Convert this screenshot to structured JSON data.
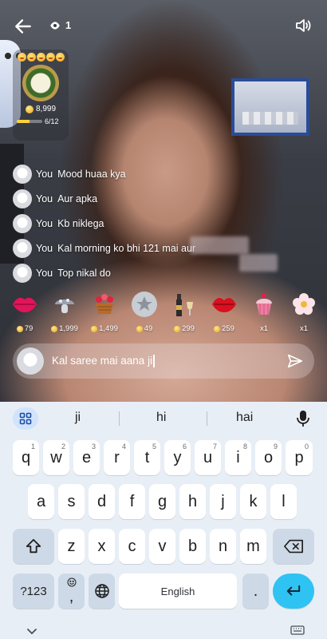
{
  "top_bar": {
    "viewer_count": "1"
  },
  "level_card": {
    "coins": "8,999",
    "progress_text": "6/12",
    "progress": 0.5
  },
  "chat": [
    {
      "user": "You",
      "text": "Mood huaa kya"
    },
    {
      "user": "You",
      "text": "Aur apka"
    },
    {
      "user": "You",
      "text": "Kb niklega"
    },
    {
      "user": "You",
      "text": "Kal morning ko bhi 121 mai aur"
    },
    {
      "user": "You",
      "text": "Top nikal do"
    }
  ],
  "gifts": [
    {
      "icon": "lips-icon",
      "price": "79"
    },
    {
      "icon": "mushroom-icon",
      "price": "1,999"
    },
    {
      "icon": "flower-basket-icon",
      "price": "1,499"
    },
    {
      "icon": "star-badge-icon",
      "price": "49"
    },
    {
      "icon": "champagne-icon",
      "price": "299"
    },
    {
      "icon": "red-lips-icon",
      "price": "259"
    },
    {
      "icon": "cupcake-icon",
      "price": "x1"
    },
    {
      "icon": "flower-icon",
      "price": "x1"
    }
  ],
  "comment": {
    "value": "Kal saree mai aana ji"
  },
  "keyboard": {
    "suggestions": [
      "ji",
      "hi",
      "hai"
    ],
    "row1": [
      {
        "key": "q",
        "hint": "1"
      },
      {
        "key": "w",
        "hint": "2"
      },
      {
        "key": "e",
        "hint": "3"
      },
      {
        "key": "r",
        "hint": "4"
      },
      {
        "key": "t",
        "hint": "5"
      },
      {
        "key": "y",
        "hint": "6"
      },
      {
        "key": "u",
        "hint": "7"
      },
      {
        "key": "i",
        "hint": "8"
      },
      {
        "key": "o",
        "hint": "9"
      },
      {
        "key": "p",
        "hint": "0"
      }
    ],
    "row2": [
      "a",
      "s",
      "d",
      "f",
      "g",
      "h",
      "j",
      "k",
      "l"
    ],
    "row3": [
      "z",
      "x",
      "c",
      "v",
      "b",
      "n",
      "m"
    ],
    "symbols_label": "?123",
    "comma_label": ",",
    "space_label": "English",
    "period_label": "."
  },
  "colors": {
    "accent": "#2ec3f2",
    "coin": "#f3b21c",
    "keyboard_bg": "#e8eef6"
  }
}
